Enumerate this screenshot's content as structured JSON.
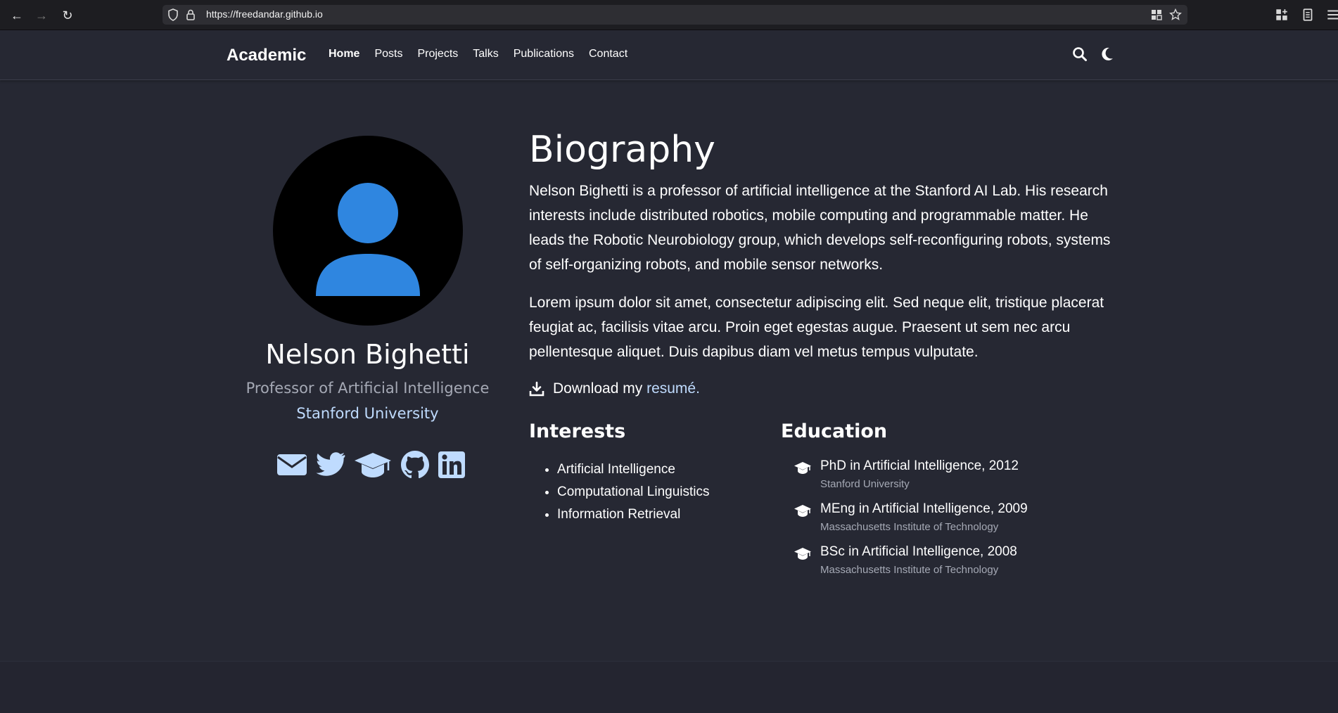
{
  "browser": {
    "url": "https://freedandar.github.io"
  },
  "nav": {
    "brand": "Academic",
    "links": [
      "Home",
      "Posts",
      "Projects",
      "Talks",
      "Publications",
      "Contact"
    ]
  },
  "profile": {
    "name": "Nelson Bighetti",
    "role": "Professor of Artificial Intelligence",
    "organization": "Stanford University"
  },
  "biography": {
    "title": "Biography",
    "paragraph1": "Nelson Bighetti is a professor of artificial intelligence at the Stanford AI Lab. His research interests include distributed robotics, mobile computing and programmable matter. He leads the Robotic Neurobiology group, which develops self-reconfiguring robots, systems of self-organizing robots, and mobile sensor networks.",
    "paragraph2": "Lorem ipsum dolor sit amet, consectetur adipiscing elit. Sed neque elit, tristique placerat feugiat ac, facilisis vitae arcu. Proin eget egestas augue. Praesent ut sem nec arcu pellentesque aliquet. Duis dapibus diam vel metus tempus vulputate.",
    "download_prefix": "Download my ",
    "download_link": "resumé",
    "download_suffix": "."
  },
  "interests": {
    "title": "Interests",
    "items": [
      "Artificial Intelligence",
      "Computational Linguistics",
      "Information Retrieval"
    ]
  },
  "education": {
    "title": "Education",
    "items": [
      {
        "course": "PhD in Artificial Intelligence, 2012",
        "institution": "Stanford University"
      },
      {
        "course": "MEng in Artificial Intelligence, 2009",
        "institution": "Massachusetts Institute of Technology"
      },
      {
        "course": "BSc in Artificial Intelligence, 2008",
        "institution": "Massachusetts Institute of Technology"
      }
    ]
  },
  "colors": {
    "background": "#262833",
    "accent": "#bfdbfe",
    "avatar_person": "#2f86e0"
  }
}
